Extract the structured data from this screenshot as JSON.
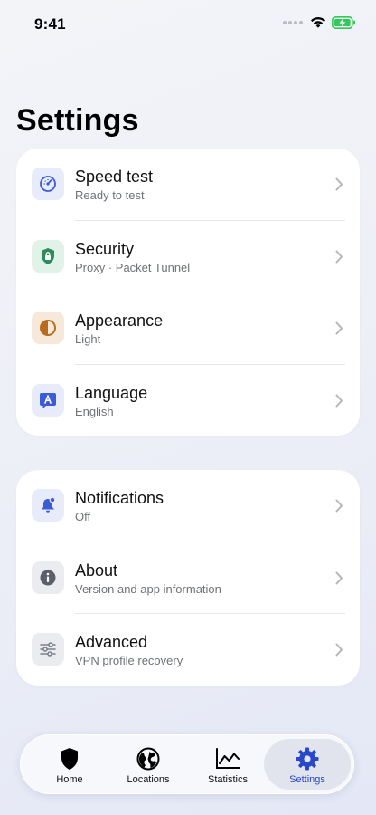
{
  "status_bar": {
    "time": "9:41"
  },
  "page": {
    "title": "Settings"
  },
  "groups": [
    {
      "items": [
        {
          "title": "Speed test",
          "subtitle": "Ready to test",
          "icon": "speedometer-icon",
          "color": "#3b5bd9",
          "bg": "#e8ebfa"
        },
        {
          "title": "Security",
          "subtitle": "Proxy · Packet Tunnel",
          "icon": "shield-lock-icon",
          "color": "#2e8b5c",
          "bg": "#e1f2e8"
        },
        {
          "title": "Appearance",
          "subtitle": "Light",
          "icon": "half-circle-icon",
          "color": "#b86a1e",
          "bg": "#f6e9da"
        },
        {
          "title": "Language",
          "subtitle": "English",
          "icon": "language-bubble-icon",
          "color": "#3b5bd9",
          "bg": "#e8ebfa"
        }
      ]
    },
    {
      "items": [
        {
          "title": "Notifications",
          "subtitle": "Off",
          "icon": "bell-icon",
          "color": "#3b5bd9",
          "bg": "#e8ebfa"
        },
        {
          "title": "About",
          "subtitle": "Version and app information",
          "icon": "info-icon",
          "color": "#5a5f6b",
          "bg": "#ebecef"
        },
        {
          "title": "Advanced",
          "subtitle": "VPN profile recovery",
          "icon": "sliders-icon",
          "color": "#7a7e88",
          "bg": "#ebecef"
        }
      ]
    }
  ],
  "tabbar": {
    "tabs": [
      {
        "label": "Home",
        "icon": "shield-icon",
        "active": false
      },
      {
        "label": "Locations",
        "icon": "globe-icon",
        "active": false
      },
      {
        "label": "Statistics",
        "icon": "chart-icon",
        "active": false
      },
      {
        "label": "Settings",
        "icon": "gear-icon",
        "active": true
      }
    ]
  },
  "colors": {
    "accent": "#2a47c9",
    "chevron": "#b4b6bc"
  }
}
